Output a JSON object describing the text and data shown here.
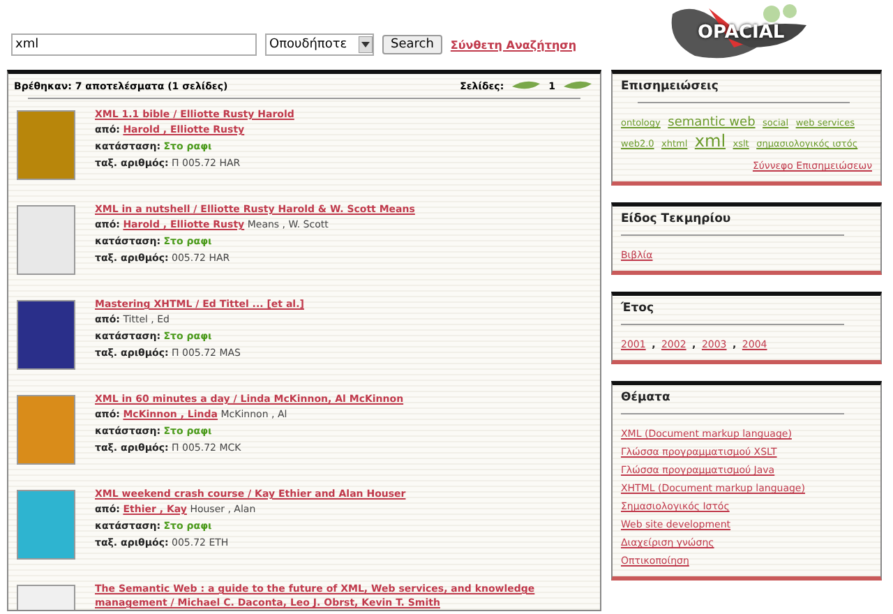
{
  "search": {
    "value": "xml",
    "scope": "Οπουδήποτε",
    "button": "Search",
    "advanced_link": "Σύνθετη Αναζήτηση"
  },
  "logo": {
    "text": "OPACIAL"
  },
  "results": {
    "summary": "Βρέθηκαν: 7 αποτελέσματα (1 σελίδες)",
    "pages_label": "Σελίδες:",
    "pages": [
      {
        "label": "1",
        "selected": true
      }
    ],
    "items": [
      {
        "title": "XML 1.1 bible / Elliotte Rusty Harold",
        "color": "#b8860b",
        "by_label": "από:",
        "authors": [
          {
            "name": "Harold , Elliotte Rusty",
            "linked": true
          }
        ],
        "status_label": "κατάσταση:",
        "status": "Στο ραφι",
        "call_label": "ταξ. αριθμός:",
        "call_number": "Π 005.72 HAR"
      },
      {
        "title": "XML in a nutshell / Elliotte Rusty Harold & W. Scott Means",
        "color": "#e8e8e8",
        "by_label": "από:",
        "authors": [
          {
            "name": "Harold , Elliotte Rusty",
            "linked": true
          },
          {
            "name": "Means , W. Scott",
            "linked": false
          }
        ],
        "status_label": "κατάσταση:",
        "status": "Στο ραφι",
        "call_label": "ταξ. αριθμός:",
        "call_number": "005.72 HAR"
      },
      {
        "title": "Mastering XHTML / Ed Tittel ... [et al.]",
        "color": "#2a2f8a",
        "by_label": "από:",
        "authors": [
          {
            "name": "Tittel , Ed",
            "linked": false
          }
        ],
        "status_label": "κατάσταση:",
        "status": "Στο ραφι",
        "call_label": "ταξ. αριθμός:",
        "call_number": "Π 005.72 MAS"
      },
      {
        "title": "XML in 60 minutes a day / Linda McKinnon, Al McKinnon",
        "color": "#d98c1a",
        "by_label": "από:",
        "authors": [
          {
            "name": "McKinnon , Linda",
            "linked": true
          },
          {
            "name": "McKinnon , Al",
            "linked": false
          }
        ],
        "status_label": "κατάσταση:",
        "status": "Στο ραφι",
        "call_label": "ταξ. αριθμός:",
        "call_number": "Π 005.72 MCK"
      },
      {
        "title": "XML weekend crash course / Kay Ethier and Alan Houser",
        "color": "#2eb4d0",
        "by_label": "από:",
        "authors": [
          {
            "name": "Ethier , Kay",
            "linked": true
          },
          {
            "name": "Houser , Alan",
            "linked": false
          }
        ],
        "status_label": "κατάσταση:",
        "status": "Στο ραφι",
        "call_label": "ταξ. αριθμός:",
        "call_number": "005.72 ETH"
      },
      {
        "title": "The Semantic Web : a guide to the future of XML, Web services, and knowledge management / Michael C. Daconta, Leo J. Obrst, Kevin T. Smith",
        "color": "#f0f0f0"
      }
    ]
  },
  "sidebar": [
    {
      "kind": "tags",
      "title": "Επισημειώσεις",
      "tags": [
        {
          "label": "ontology",
          "kind": "small"
        },
        {
          "label": "semantic web",
          "kind": "medium"
        },
        {
          "label": "social",
          "kind": "small"
        },
        {
          "label": "web services",
          "kind": "small"
        },
        {
          "label": "web2.0",
          "kind": "small"
        },
        {
          "label": "xhtml",
          "kind": "small"
        },
        {
          "label": "xml",
          "kind": "large"
        },
        {
          "label": "xslt",
          "kind": "small"
        },
        {
          "label": "σημασιολογικός ιστός",
          "kind": "small"
        }
      ],
      "more_link": "Σύννεφο Επισημειώσεων"
    },
    {
      "kind": "links",
      "title": "Είδος Τεκμηρίου",
      "links": [
        "Βιβλία"
      ]
    },
    {
      "kind": "inline",
      "title": "Έτος",
      "separator": ",",
      "links": [
        "2001",
        "2002",
        "2003",
        "2004"
      ]
    },
    {
      "kind": "links",
      "title": "Θέματα",
      "links": [
        "XML (Document markup language)",
        "Γλώσσα προγραμματισμού XSLT",
        "Γλώσσα προγραμματισμού Java",
        "XHTML (Document markup language)",
        "Σημασιολογικός Ιστός",
        "Web site development",
        "Διαχείριση γνώσης",
        "Οπτικοποίηση"
      ]
    }
  ]
}
